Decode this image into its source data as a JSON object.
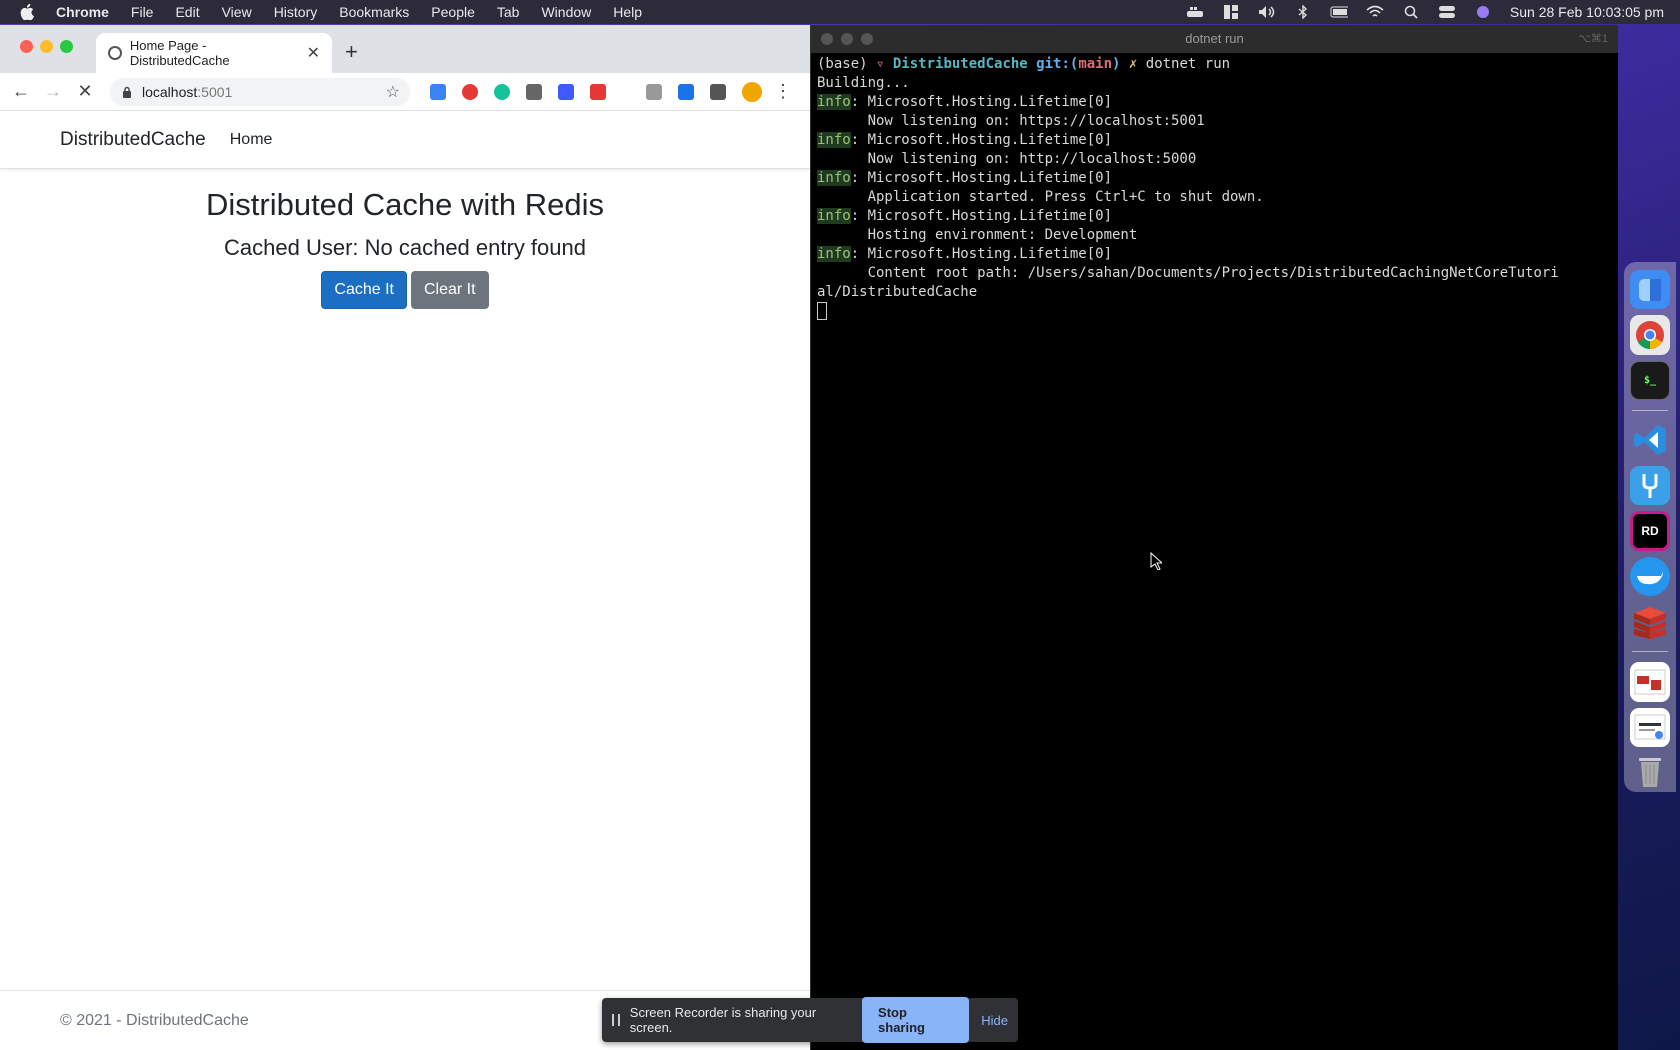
{
  "menubar": {
    "app": "Chrome",
    "items": [
      "File",
      "Edit",
      "View",
      "History",
      "Bookmarks",
      "People",
      "Tab",
      "Window",
      "Help"
    ],
    "clock": "Sun 28 Feb  10:03:05 pm"
  },
  "browser": {
    "tab_title": "Home Page - DistributedCache",
    "url_host": "localhost",
    "url_port": ":5001"
  },
  "site": {
    "brand": "DistributedCache",
    "nav_home": "Home",
    "heading": "Distributed Cache with Redis",
    "cached_user": "Cached User: No cached entry found",
    "cache_button": "Cache It",
    "clear_button": "Clear It",
    "footer": "© 2021 - DistributedCache"
  },
  "terminal": {
    "title": "dotnet run",
    "shortcut": "⌥⌘1",
    "prompt_base": "(base) ",
    "prompt_tri": "▿ ",
    "prompt_dir": "DistributedCache",
    "prompt_git": " git:(",
    "prompt_branch": "main",
    "prompt_git_end": ")",
    "prompt_x": " ✗ ",
    "command": "dotnet run",
    "building": "Building...",
    "log": [
      {
        "level": "info",
        "src": ": Microsoft.Hosting.Lifetime[0]",
        "msg": "      Now listening on: https://localhost:5001"
      },
      {
        "level": "info",
        "src": ": Microsoft.Hosting.Lifetime[0]",
        "msg": "      Now listening on: http://localhost:5000"
      },
      {
        "level": "info",
        "src": ": Microsoft.Hosting.Lifetime[0]",
        "msg": "      Application started. Press Ctrl+C to shut down."
      },
      {
        "level": "info",
        "src": ": Microsoft.Hosting.Lifetime[0]",
        "msg": "      Hosting environment: Development"
      },
      {
        "level": "info",
        "src": ": Microsoft.Hosting.Lifetime[0]",
        "msg": "      Content root path: /Users/sahan/Documents/Projects/DistributedCachingNetCoreTutori"
      }
    ],
    "wrap": "al/DistributedCache"
  },
  "dock": {
    "items": [
      {
        "name": "finder",
        "color": "#3f8cf5",
        "label": ""
      },
      {
        "name": "chrome",
        "color": "#e5e5e5",
        "label": ""
      },
      {
        "name": "terminal",
        "color": "#1a1a1a",
        "label": "$_"
      },
      {
        "name": "vscode",
        "color": "#2a8de0",
        "label": ""
      },
      {
        "name": "fork",
        "color": "#3aa0e8",
        "label": ""
      },
      {
        "name": "rider",
        "color": "#000000",
        "label": "RD"
      },
      {
        "name": "docker",
        "color": "#2496ed",
        "label": ""
      },
      {
        "name": "redis",
        "color": "#c6302b",
        "label": ""
      }
    ]
  },
  "share_bar": {
    "message": "Screen Recorder is sharing your screen.",
    "stop": "Stop sharing",
    "hide": "Hide"
  }
}
